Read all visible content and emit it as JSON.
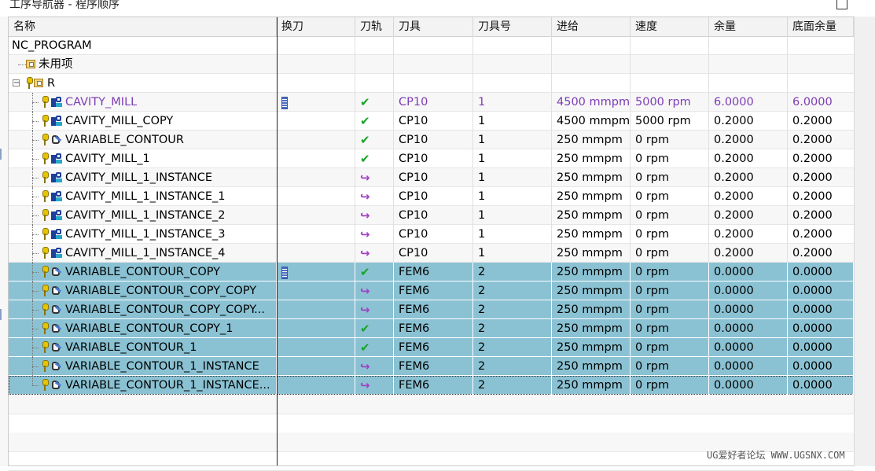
{
  "window": {
    "title": "工序导航器 - 程序顺序"
  },
  "columns": [
    "名称",
    "换刀",
    "刀轨",
    "刀具",
    "刀具号",
    "进给",
    "速度",
    "余量",
    "底面余量"
  ],
  "root": {
    "label": "NC_PROGRAM"
  },
  "unused": {
    "label": "未用项"
  },
  "program": {
    "label": "R",
    "expander": "−"
  },
  "rows": [
    {
      "name": "CAVITY_MILL",
      "icon": "mill-op-icon",
      "tool_change": true,
      "path": "✔",
      "tool": "CP10",
      "tool_num": "1",
      "feed": "4500 mmpm",
      "speed": "5000 rpm",
      "stock": "6.0000",
      "floor_stock": "6.0000"
    },
    {
      "name": "CAVITY_MILL_COPY",
      "icon": "mill-op-icon",
      "tool_change": false,
      "path": "✔",
      "tool": "CP10",
      "tool_num": "1",
      "feed": "4500 mmpm",
      "speed": "5000 rpm",
      "stock": "0.2000",
      "floor_stock": "0.2000"
    },
    {
      "name": "VARIABLE_CONTOUR",
      "icon": "contour-op-icon",
      "tool_change": false,
      "path": "✔",
      "tool": "CP10",
      "tool_num": "1",
      "feed": "250 mmpm",
      "speed": "0 rpm",
      "stock": "0.2000",
      "floor_stock": "0.2000"
    },
    {
      "name": "CAVITY_MILL_1",
      "icon": "mill-op-icon",
      "tool_change": false,
      "path": "✔",
      "tool": "CP10",
      "tool_num": "1",
      "feed": "250 mmpm",
      "speed": "0 rpm",
      "stock": "0.2000",
      "floor_stock": "0.2000"
    },
    {
      "name": "CAVITY_MILL_1_INSTANCE",
      "icon": "mill-op-icon",
      "tool_change": false,
      "path": "↪",
      "tool": "CP10",
      "tool_num": "1",
      "feed": "250 mmpm",
      "speed": "0 rpm",
      "stock": "0.2000",
      "floor_stock": "0.2000"
    },
    {
      "name": "CAVITY_MILL_1_INSTANCE_1",
      "icon": "mill-op-icon",
      "tool_change": false,
      "path": "↪",
      "tool": "CP10",
      "tool_num": "1",
      "feed": "250 mmpm",
      "speed": "0 rpm",
      "stock": "0.2000",
      "floor_stock": "0.2000"
    },
    {
      "name": "CAVITY_MILL_1_INSTANCE_2",
      "icon": "mill-op-icon",
      "tool_change": false,
      "path": "↪",
      "tool": "CP10",
      "tool_num": "1",
      "feed": "250 mmpm",
      "speed": "0 rpm",
      "stock": "0.2000",
      "floor_stock": "0.2000"
    },
    {
      "name": "CAVITY_MILL_1_INSTANCE_3",
      "icon": "mill-op-icon",
      "tool_change": false,
      "path": "↪",
      "tool": "CP10",
      "tool_num": "1",
      "feed": "250 mmpm",
      "speed": "0 rpm",
      "stock": "0.2000",
      "floor_stock": "0.2000"
    },
    {
      "name": "CAVITY_MILL_1_INSTANCE_4",
      "icon": "mill-op-icon",
      "tool_change": false,
      "path": "↪",
      "tool": "CP10",
      "tool_num": "1",
      "feed": "250 mmpm",
      "speed": "0 rpm",
      "stock": "0.2000",
      "floor_stock": "0.2000"
    },
    {
      "name": "VARIABLE_CONTOUR_COPY",
      "icon": "contour-op-icon",
      "tool_change": true,
      "path": "✔",
      "tool": "FEM6",
      "tool_num": "2",
      "feed": "250 mmpm",
      "speed": "0 rpm",
      "stock": "0.0000",
      "floor_stock": "0.0000",
      "selected": true
    },
    {
      "name": "VARIABLE_CONTOUR_COPY_COPY",
      "icon": "contour-op-icon",
      "tool_change": false,
      "path": "↪",
      "tool": "FEM6",
      "tool_num": "2",
      "feed": "250 mmpm",
      "speed": "0 rpm",
      "stock": "0.0000",
      "floor_stock": "0.0000",
      "selected": true
    },
    {
      "name": "VARIABLE_CONTOUR_COPY_COPY...",
      "icon": "contour-op-icon",
      "tool_change": false,
      "path": "↪",
      "tool": "FEM6",
      "tool_num": "2",
      "feed": "250 mmpm",
      "speed": "0 rpm",
      "stock": "0.0000",
      "floor_stock": "0.0000",
      "selected": true
    },
    {
      "name": "VARIABLE_CONTOUR_COPY_1",
      "icon": "contour-op-icon",
      "tool_change": false,
      "path": "✔",
      "tool": "FEM6",
      "tool_num": "2",
      "feed": "250 mmpm",
      "speed": "0 rpm",
      "stock": "0.0000",
      "floor_stock": "0.0000",
      "selected": true
    },
    {
      "name": "VARIABLE_CONTOUR_1",
      "icon": "contour-op-icon",
      "tool_change": false,
      "path": "✔",
      "tool": "FEM6",
      "tool_num": "2",
      "feed": "250 mmpm",
      "speed": "0 rpm",
      "stock": "0.0000",
      "floor_stock": "0.0000",
      "selected": true
    },
    {
      "name": "VARIABLE_CONTOUR_1_INSTANCE",
      "icon": "contour-op-icon",
      "tool_change": false,
      "path": "↪",
      "tool": "FEM6",
      "tool_num": "2",
      "feed": "250 mmpm",
      "speed": "0 rpm",
      "stock": "0.0000",
      "floor_stock": "0.0000",
      "selected": true
    },
    {
      "name": "VARIABLE_CONTOUR_1_INSTANCE...",
      "icon": "contour-op-icon",
      "tool_change": false,
      "path": "↪",
      "tool": "FEM6",
      "tool_num": "2",
      "feed": "250 mmpm",
      "speed": "0 rpm",
      "stock": "0.0000",
      "floor_stock": "0.0000",
      "selected": true,
      "focused": true
    }
  ],
  "colors": {
    "selection": "#8ac2d3",
    "highlight_text": "#7d3cb5",
    "check": "#1aa32a",
    "arrow": "#a23fc7"
  },
  "watermark": "UG爱好者论坛 WWW.UGSNX.COM"
}
